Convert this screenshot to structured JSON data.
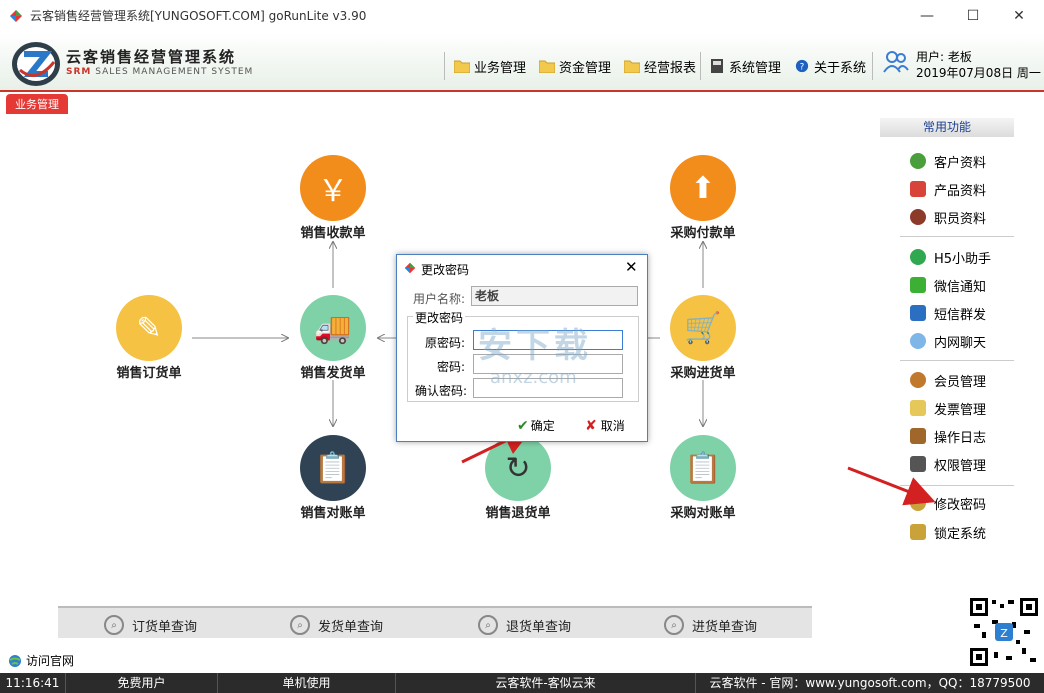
{
  "window": {
    "title": "云客销售经营管理系统[YUNGOSOFT.COM]  goRunLite v3.90",
    "minimize": "—",
    "maximize": "☐",
    "close": "✕"
  },
  "brand": {
    "name_cn": "云客销售经营管理系统",
    "name_en_prefix": "SRM",
    "name_en": " SALES MANAGEMENT SYSTEM",
    "accent_color": "#c8362b"
  },
  "menu": [
    {
      "label": "业务管理",
      "icon": "folder-icon"
    },
    {
      "label": "资金管理",
      "icon": "folder-icon"
    },
    {
      "label": "经营报表",
      "icon": "folder-icon"
    },
    {
      "label": "系统管理",
      "icon": "system-icon"
    },
    {
      "label": "关于系统",
      "icon": "help-icon"
    }
  ],
  "user": {
    "name": "用户: 老板",
    "date": "2019年07月08日 周一"
  },
  "tab": {
    "label": "业务管理"
  },
  "sidebar": {
    "header": "常用功能",
    "items": [
      {
        "label": "客户资料",
        "icon": "customer-icon",
        "color": "#4a9e3c"
      },
      {
        "label": "产品资料",
        "icon": "product-icon",
        "color": "#d9443a"
      },
      {
        "label": "职员资料",
        "icon": "staff-icon",
        "color": "#8c3a2a"
      },
      {
        "label": "H5小助手",
        "icon": "check-icon",
        "color": "#2fa84f"
      },
      {
        "label": "微信通知",
        "icon": "wechat-icon",
        "color": "#3cb034"
      },
      {
        "label": "短信群发",
        "icon": "sms-icon",
        "color": "#2a6fc2"
      },
      {
        "label": "内网聊天",
        "icon": "chat-icon",
        "color": "#7fb6e8"
      },
      {
        "label": "会员管理",
        "icon": "member-icon",
        "color": "#c0782d"
      },
      {
        "label": "发票管理",
        "icon": "invoice-icon",
        "color": "#e6c85a"
      },
      {
        "label": "操作日志",
        "icon": "log-icon",
        "color": "#a0672b"
      },
      {
        "label": "权限管理",
        "icon": "monitor-icon",
        "color": "#555555"
      },
      {
        "label": "修改密码",
        "icon": "key-icon",
        "color": "#c9a23a"
      },
      {
        "label": "锁定系统",
        "icon": "lock-icon",
        "color": "#c9a23a"
      }
    ]
  },
  "flow": {
    "nodes": {
      "sales_receipt": {
        "label": "销售收款单",
        "color": "#f28c1a",
        "glyph": "￥"
      },
      "sales_order": {
        "label": "销售订货单",
        "color": "#f5c243",
        "glyph": "✎"
      },
      "sales_delivery": {
        "label": "销售发货单",
        "color": "#7fd1a8",
        "glyph": "🚚"
      },
      "sales_statement": {
        "label": "销售对账单",
        "color": "#2f4354",
        "glyph": "📋"
      },
      "sales_return": {
        "label": "销售退货单",
        "color": "#7fd1a8",
        "glyph": "↻"
      },
      "purchase_payment": {
        "label": "采购付款单",
        "color": "#f28c1a",
        "glyph": "⬆"
      },
      "purchase_receipt": {
        "label": "采购进货单",
        "color": "#f5c243",
        "glyph": "🛒"
      },
      "purchase_statement": {
        "label": "采购对账单",
        "color": "#7fd1a8",
        "glyph": "📋"
      }
    }
  },
  "queries": [
    {
      "label": "订货单查询"
    },
    {
      "label": "发货单查询"
    },
    {
      "label": "退货单查询"
    },
    {
      "label": "进货单查询"
    }
  ],
  "visit": {
    "label": "访问官网"
  },
  "status": {
    "time": "11:16:41",
    "user_type": "免费用户",
    "mode": "单机使用",
    "slogan": "云客软件-客似云来",
    "contact": "云客软件 - 官网：www.yungosoft.com，QQ：18779500"
  },
  "dialog": {
    "title": "更改密码",
    "username_label": "用户名称:",
    "username_value": "老板",
    "group_label": "更改密码",
    "old_pwd_label": "原密码:",
    "new_pwd_label": "密码:",
    "confirm_pwd_label": "确认密码:",
    "ok_label": "确定",
    "cancel_label": "取消"
  },
  "watermark": {
    "text_cn": "安下载",
    "text_en": "anxz.com"
  }
}
